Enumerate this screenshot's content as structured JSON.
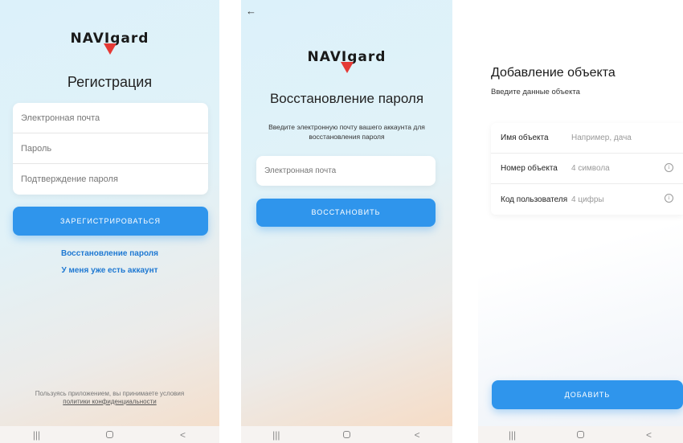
{
  "brand": {
    "logo_text": "NAVIgard",
    "accent": "#2f95ec",
    "logo_red": "#e53935"
  },
  "register": {
    "title": "Регистрация",
    "fields": [
      {
        "placeholder": "Электронная почта"
      },
      {
        "placeholder": "Пароль"
      },
      {
        "placeholder": "Подтверждение пароля"
      }
    ],
    "submit_label": "ЗАРЕГИСТРИРОВАТЬСЯ",
    "link_recover": "Восстановление пароля",
    "link_have_account": "У меня уже есть аккаунт",
    "terms_text": "Пользуясь приложением, вы принимаете условия",
    "terms_link": "политики конфиденциальности"
  },
  "recover": {
    "back_icon": "arrow-left-icon",
    "title": "Восстановление пароля",
    "description": "Введите электронную почту вашего аккаунта для восстановления пароля",
    "email_placeholder": "Электронная почта",
    "submit_label": "ВОССТАНОВИТЬ"
  },
  "add_object": {
    "title": "Добавление объекта",
    "subtitle": "Введите данные объекта",
    "rows": [
      {
        "label": "Имя объекта",
        "placeholder": "Например, дача",
        "info": false
      },
      {
        "label": "Номер объекта",
        "placeholder": "4 символа",
        "info": true
      },
      {
        "label": "Код пользователя",
        "placeholder": "4 цифры",
        "info": true
      }
    ],
    "submit_label": "ДОБАВИТЬ"
  },
  "navbar": {
    "recent": "|||",
    "home_icon": "home-icon",
    "back": "<"
  }
}
